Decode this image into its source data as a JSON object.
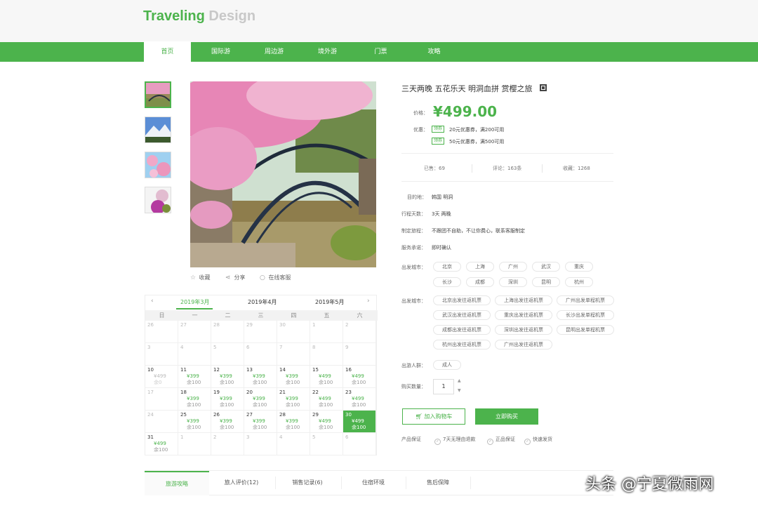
{
  "brand": {
    "part1": "Traveling",
    "part2": "Design"
  },
  "nav": [
    "首页",
    "国际游",
    "周边游",
    "境外游",
    "门票",
    "攻略"
  ],
  "product": {
    "title": "三天两晚 五花乐天 明洞血拼 赏樱之旅",
    "price_label": "价格：",
    "price": "¥499.00",
    "coupon_label": "优惠：",
    "coupons": [
      {
        "tag": "领券",
        "text": "20元优惠券，满200可用"
      },
      {
        "tag": "领券",
        "text": "50元优惠券，满500可用"
      }
    ],
    "stats": [
      "已售：69",
      "评论：163条",
      "收藏：1268"
    ],
    "details": [
      {
        "label": "目的地：",
        "value": "韩国  明洞"
      },
      {
        "label": "行程天数：",
        "value": "3天  两晚"
      },
      {
        "label": "制定旅程：",
        "value": "不跟团不自助，不让你费心，联系客服制定"
      },
      {
        "label": "服务承诺：",
        "value": "即时确认"
      }
    ],
    "departure_label": "出发城市：",
    "departure_cities": [
      "北京",
      "上海",
      "广州",
      "武汉",
      "重庆",
      "长沙",
      "成都",
      "深圳",
      "昆明",
      "杭州"
    ],
    "ticket_label": "出发城市：",
    "tickets": [
      "北京出发往返机票",
      "上海出发往返机票",
      "广州出发单程机票",
      "武汉出发往返机票",
      "重庆出发往返机票",
      "长沙出发单程机票",
      "成都出发往返机票",
      "深圳出发往返机票",
      "昆明出发单程机票",
      "杭州出发往返机票",
      "广州出发往返机票"
    ],
    "people_label": "出游人群：",
    "people": "成人",
    "qty_label": "购买数量：",
    "qty": "1",
    "cart_btn": "加入购物车",
    "buy_btn": "立即购买",
    "guarantee_label": "产品保证",
    "guarantees": [
      "7天无理由退款",
      "正品保证",
      "快速发货"
    ]
  },
  "actions": [
    "收藏",
    "分享",
    "在线客服"
  ],
  "calendar": {
    "months": [
      "2019年3月",
      "2019年4月",
      "2019年5月"
    ],
    "weekdays": [
      "日",
      "一",
      "二",
      "三",
      "四",
      "五",
      "六"
    ],
    "weeks": [
      [
        {
          "d": "26"
        },
        {
          "d": "27"
        },
        {
          "d": "28"
        },
        {
          "d": "29"
        },
        {
          "d": "30"
        },
        {
          "d": "1"
        },
        {
          "d": "2"
        }
      ],
      [
        {
          "d": "3"
        },
        {
          "d": "4"
        },
        {
          "d": "5"
        },
        {
          "d": "6"
        },
        {
          "d": "7"
        },
        {
          "d": "8"
        },
        {
          "d": "9"
        }
      ],
      [
        {
          "d": "10",
          "p": "¥499",
          "r": "余0",
          "past": true
        },
        {
          "d": "11",
          "p": "¥399",
          "r": "余100"
        },
        {
          "d": "12",
          "p": "¥399",
          "r": "余100"
        },
        {
          "d": "13",
          "p": "¥399",
          "r": "余100"
        },
        {
          "d": "14",
          "p": "¥399",
          "r": "余100"
        },
        {
          "d": "15",
          "p": "¥499",
          "r": "余100"
        },
        {
          "d": "16",
          "p": "¥499",
          "r": "余100"
        }
      ],
      [
        {
          "d": "17"
        },
        {
          "d": "18",
          "p": "¥399",
          "r": "余100"
        },
        {
          "d": "19",
          "p": "¥399",
          "r": "余100"
        },
        {
          "d": "20",
          "p": "¥399",
          "r": "余100"
        },
        {
          "d": "21",
          "p": "¥399",
          "r": "余100"
        },
        {
          "d": "22",
          "p": "¥499",
          "r": "余100"
        },
        {
          "d": "23",
          "p": "¥499",
          "r": "余100"
        }
      ],
      [
        {
          "d": "24"
        },
        {
          "d": "25",
          "p": "¥399",
          "r": "余100"
        },
        {
          "d": "26",
          "p": "¥399",
          "r": "余100"
        },
        {
          "d": "27",
          "p": "¥399",
          "r": "余100"
        },
        {
          "d": "28",
          "p": "¥399",
          "r": "余100"
        },
        {
          "d": "29",
          "p": "¥499",
          "r": "余100"
        },
        {
          "d": "30",
          "p": "¥499",
          "r": "余100",
          "sel": true
        }
      ],
      [
        {
          "d": "31",
          "p": "¥499",
          "r": "余100"
        },
        {
          "d": "1"
        },
        {
          "d": "2"
        },
        {
          "d": "3"
        },
        {
          "d": "4"
        },
        {
          "d": "5"
        },
        {
          "d": "6"
        }
      ]
    ]
  },
  "tabs": [
    "旅游攻略",
    "旅人评价(12)",
    "销售记录(6)",
    "住宿环境",
    "售后保障"
  ],
  "watermark": "头条 @宁夏微雨网",
  "colors": {
    "accent": "#4cb34c"
  }
}
